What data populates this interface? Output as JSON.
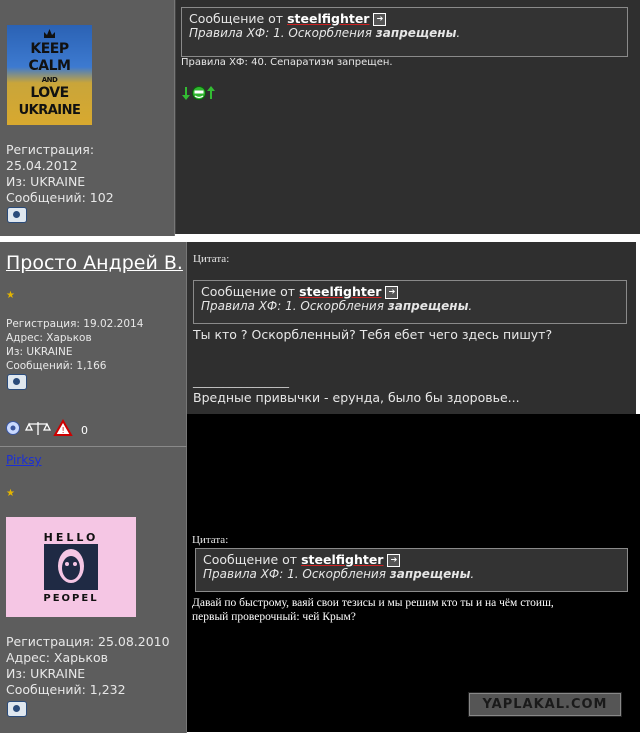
{
  "post1": {
    "avatar_lines": [
      "KEEP",
      "CALM",
      "AND",
      "LOVE",
      "UKRAINE"
    ],
    "registration": "Регистрация:",
    "registration_date": "25.04.2012",
    "from": "Из: UKRAINE",
    "messages": "Сообщений:  102",
    "quote_from_prefix": "Сообщение от",
    "quote_author": "steelfighter",
    "quote_rule": "Правила ХФ: 1. Оскорбления",
    "quote_rule_bold": "запрещены",
    "body": "Правила ХФ: 40. Сепаратизм запрещен."
  },
  "post2": {
    "username": "Просто Андрей В.",
    "registration": "Регистрация: 19.02.2014",
    "address": "Адрес: Харьков",
    "from": "Из: UKRAINE",
    "messages": "Сообщений: 1,166",
    "quote_label": "Цитата:",
    "quote_from_prefix": "Сообщение от",
    "quote_author": "steelfighter",
    "quote_rule": "Правила ХФ: 1. Оскорбления",
    "quote_rule_bold": "запрещены",
    "body": "Ты кто ? Оскорбленный? Тебя ебет чего здесь пишут?",
    "signature_line": "________________",
    "signature": "Вредные привычки  - ерунда, было бы здоровье..."
  },
  "post3": {
    "username": "Pirksy",
    "avatar_top": "HELLO",
    "avatar_bottom": "PEOPEL",
    "registration": "Регистрация:  25.08.2010",
    "address": "Адрес: Харьков",
    "from": "Из: UKRAINE",
    "messages": "Сообщений: 1,232",
    "quote_label": "Цитата:",
    "quote_from_prefix": "Сообщение от",
    "quote_author": "steelfighter",
    "quote_rule": "Правила ХФ: 1. Оскорбления",
    "quote_rule_bold": "запрещены",
    "body_line1": "Давай по быстрому, ваяй свои тезисы и мы решим кто ты и на чём стоиш,",
    "body_line2": "первый проверочный: чей Крым?"
  },
  "watermark": "YAPLAKAL.COM",
  "icons": {
    "quote_link": "arrow-box-icon",
    "camera": "camera-icon",
    "rating": "star-icon",
    "smiley": "green-smiley-icon"
  }
}
